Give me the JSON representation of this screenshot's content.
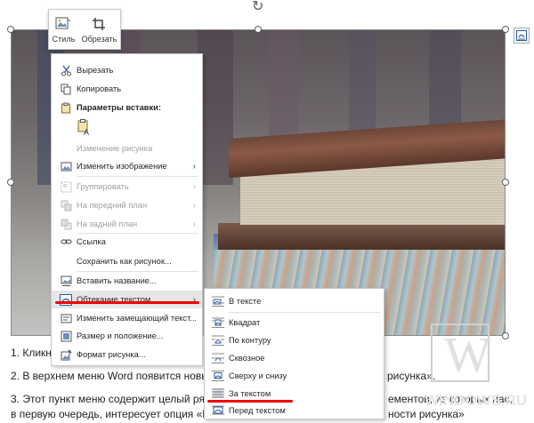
{
  "mini_toolbar": {
    "style_label": "Стиль",
    "crop_label": "Обрезать"
  },
  "context_menu": {
    "items": [
      {
        "label": "Вырезать",
        "icon": "scissors-icon",
        "enabled": true
      },
      {
        "label": "Копировать",
        "icon": "copy-icon",
        "enabled": true
      },
      {
        "label": "Параметры вставки:",
        "icon": "paste-icon",
        "enabled": true
      },
      {
        "label": "Изменение рисунка",
        "icon": "",
        "enabled": false
      },
      {
        "label": "Изменить изображение",
        "icon": "change-picture-icon",
        "enabled": true
      },
      {
        "label": "Группировать",
        "icon": "group-icon",
        "enabled": false
      },
      {
        "label": "На передний план",
        "icon": "bring-forward-icon",
        "enabled": false
      },
      {
        "label": "На задний план",
        "icon": "send-backward-icon",
        "enabled": false
      },
      {
        "label": "Ссылка",
        "icon": "link-icon",
        "enabled": true
      },
      {
        "label": "Сохранить как рисунок...",
        "icon": "",
        "enabled": true
      },
      {
        "label": "Вставить название...",
        "icon": "caption-icon",
        "enabled": true
      },
      {
        "label": "Обтекание текстом",
        "icon": "wrap-text-icon",
        "enabled": true
      },
      {
        "label": "Изменить замещающий текст...",
        "icon": "alt-text-icon",
        "enabled": true
      },
      {
        "label": "Размер и положение...",
        "icon": "size-position-icon",
        "enabled": true
      },
      {
        "label": "Формат рисунка...",
        "icon": "format-picture-icon",
        "enabled": true
      }
    ],
    "paste_option_glyph": "A"
  },
  "wrap_submenu": {
    "items": [
      {
        "label": "В тексте",
        "icon": "wrap-inline-icon"
      },
      {
        "label": "Квадрат",
        "icon": "wrap-square-icon"
      },
      {
        "label": "По контуру",
        "icon": "wrap-tight-icon"
      },
      {
        "label": "Сквозное",
        "icon": "wrap-through-icon"
      },
      {
        "label": "Сверху и снизу",
        "icon": "wrap-top-bottom-icon"
      },
      {
        "label": "За текстом",
        "icon": "wrap-behind-icon"
      },
      {
        "label": "Перед текстом",
        "icon": "wrap-front-icon"
      }
    ]
  },
  "document": {
    "line1": "1. Кликн",
    "line2_left": "2. В верхнем меню Word появится новы",
    "line2_right": "рисунка».",
    "line3_left": "3. Этот пункт меню содержит целый ряд",
    "line3_right": "ементов, из которых нас,",
    "line4_left": "в первую очередь, интересует опция «П",
    "line4_right": "ности рисунка»"
  },
  "watermark": {
    "letter": "W",
    "site": "WINDOWS.RU"
  },
  "colors": {
    "accent_blue": "#2b579a",
    "highlight": "#e6e6e6",
    "annotation_red": "#e00000"
  }
}
